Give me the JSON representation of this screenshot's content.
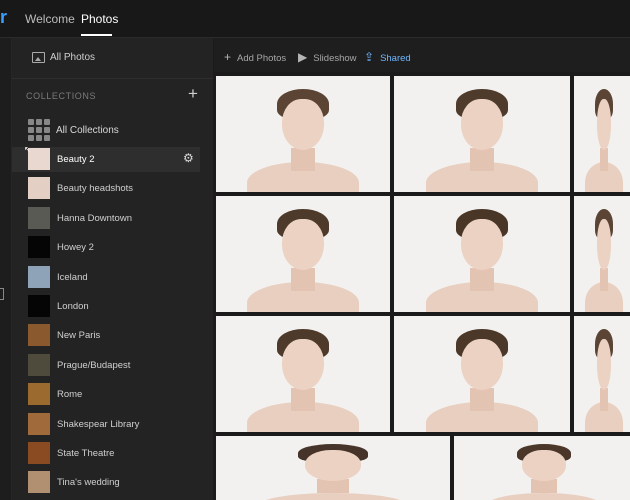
{
  "app": {
    "logo_char": "r",
    "accent": "#3aa0ff"
  },
  "tabs": [
    {
      "label": "Welcome",
      "active": false
    },
    {
      "label": "Photos",
      "active": true
    }
  ],
  "sidebar": {
    "all_photos_label": "All Photos",
    "collections_heading": "COLLECTIONS",
    "add_symbol": "+",
    "all_collections_label": "All Collections",
    "items": [
      {
        "label": "Beauty 2",
        "selected": true,
        "thumb": "#e8d8cf"
      },
      {
        "label": "Beauty headshots",
        "selected": false,
        "thumb": "#e3cfc4"
      },
      {
        "label": "Hanna Downtown",
        "selected": false,
        "thumb": "#5a5a55"
      },
      {
        "label": "Howey 2",
        "selected": false,
        "thumb": "#050505"
      },
      {
        "label": "Iceland",
        "selected": false,
        "thumb": "#8fa3b8"
      },
      {
        "label": "London",
        "selected": false,
        "thumb": "#050505"
      },
      {
        "label": "New Paris",
        "selected": false,
        "thumb": "#8a5a2e"
      },
      {
        "label": "Prague/Budapest",
        "selected": false,
        "thumb": "#4e4a3c"
      },
      {
        "label": "Rome",
        "selected": false,
        "thumb": "#9a6a2e"
      },
      {
        "label": "Shakespear Library",
        "selected": false,
        "thumb": "#a06a3a"
      },
      {
        "label": "State Theatre",
        "selected": false,
        "thumb": "#8a4a22"
      },
      {
        "label": "Tina's wedding",
        "selected": false,
        "thumb": "#b09070"
      }
    ]
  },
  "toolbar": {
    "add_photos": "Add Photos",
    "slideshow": "Slideshow",
    "shared": "Shared"
  },
  "photos": [
    {
      "hair": "#5b4433"
    },
    {
      "hair": "#4f3b2c"
    },
    {
      "hair": "#5b4433"
    },
    {
      "hair": "#4d3a2b"
    },
    {
      "hair": "#4a3627"
    },
    {
      "hair": "#5b4433"
    },
    {
      "hair": "#4e3a2b"
    },
    {
      "hair": "#4b3829"
    },
    {
      "hair": "#5b4433"
    },
    {
      "hair": "#46342a"
    },
    {
      "hair": "#4a372a"
    }
  ]
}
